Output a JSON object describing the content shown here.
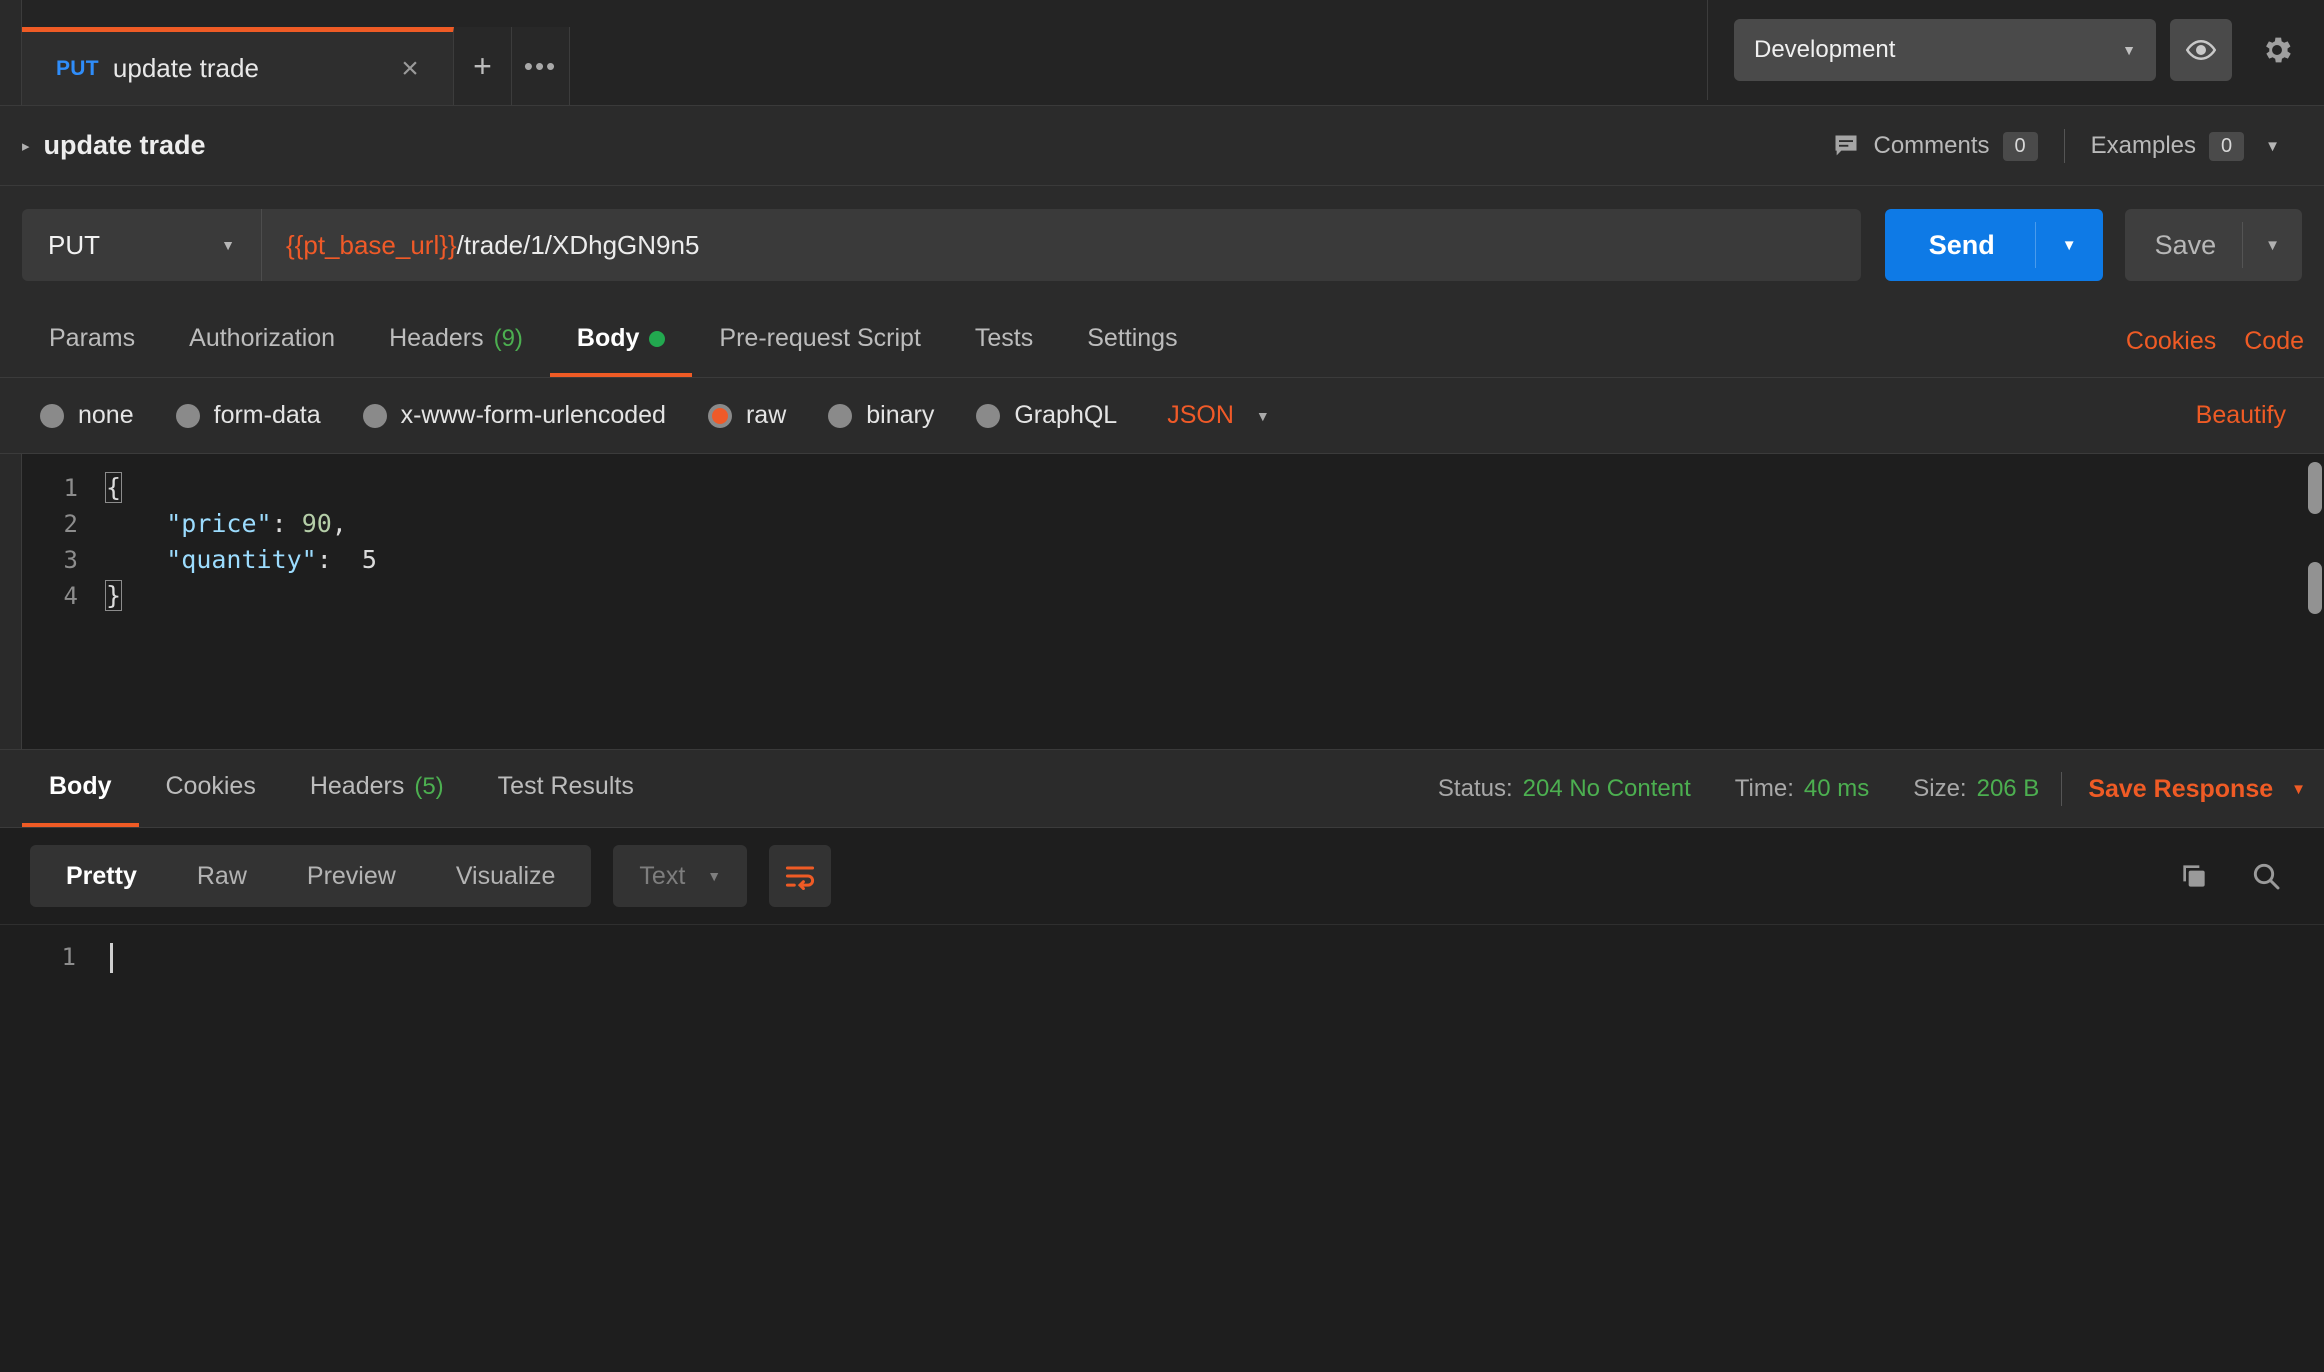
{
  "window": {
    "tab": {
      "method": "PUT",
      "name": "update trade",
      "close_label": "×",
      "new_tab_label": "+",
      "more_label": "•••"
    },
    "environment": {
      "selected": "Development",
      "caret": "▼"
    },
    "icons": {
      "eye": "eye-icon",
      "gear": "gear-icon"
    }
  },
  "breadcrumb": {
    "expander": "▸",
    "title": "update trade",
    "comments_label": "Comments",
    "comments_count": "0",
    "examples_label": "Examples",
    "examples_count": "0",
    "caret": "▼"
  },
  "request": {
    "method": "PUT",
    "method_caret": "▼",
    "url_variable": "{{pt_base_url}}",
    "url_path": "/trade/1/XDhgGN9n5",
    "send_label": "Send",
    "send_caret": "▼",
    "save_label": "Save",
    "save_caret": "▼",
    "tabs": [
      {
        "label": "Params",
        "count": "",
        "active": false
      },
      {
        "label": "Authorization",
        "count": "",
        "active": false
      },
      {
        "label": "Headers",
        "count": "(9)",
        "active": false
      },
      {
        "label": "Body",
        "count": "",
        "active": true
      },
      {
        "label": "Pre-request Script",
        "count": "",
        "active": false
      },
      {
        "label": "Tests",
        "count": "",
        "active": false
      },
      {
        "label": "Settings",
        "count": "",
        "active": false
      }
    ],
    "cookies_link": "Cookies",
    "code_link": "Code",
    "body_types": [
      {
        "label": "none",
        "selected": false
      },
      {
        "label": "form-data",
        "selected": false
      },
      {
        "label": "x-www-form-urlencoded",
        "selected": false
      },
      {
        "label": "raw",
        "selected": true
      },
      {
        "label": "binary",
        "selected": false
      },
      {
        "label": "GraphQL",
        "selected": false
      }
    ],
    "raw_format": "JSON",
    "raw_format_caret": "▼",
    "beautify_label": "Beautify",
    "body_lines": [
      {
        "number": "1",
        "text": "{"
      },
      {
        "number": "2",
        "text": "    \"price\": 90,"
      },
      {
        "number": "3",
        "text": "    \"quantity\":  5"
      },
      {
        "number": "4",
        "text": "}"
      }
    ],
    "body_code": {
      "line1_brace": "{",
      "line2_key": "\"price\"",
      "line2_colon": ": ",
      "line2_value": "90",
      "line2_comma": ",",
      "line3_key": "\"quantity\"",
      "line3_colon": ":  ",
      "line3_value": "5",
      "line4_brace": "}"
    }
  },
  "response": {
    "tabs": [
      {
        "label": "Body",
        "count": "",
        "active": true
      },
      {
        "label": "Cookies",
        "count": "",
        "active": false
      },
      {
        "label": "Headers",
        "count": "(5)",
        "active": false
      },
      {
        "label": "Test Results",
        "count": "",
        "active": false
      }
    ],
    "status_label": "Status:",
    "status_value": "204 No Content",
    "time_label": "Time:",
    "time_value": "40 ms",
    "size_label": "Size:",
    "size_value": "206 B",
    "save_response_label": "Save Response",
    "save_response_caret": "▼",
    "view_modes": [
      {
        "label": "Pretty",
        "active": true
      },
      {
        "label": "Raw",
        "active": false
      },
      {
        "label": "Preview",
        "active": false
      },
      {
        "label": "Visualize",
        "active": false
      }
    ],
    "format_select": "Text",
    "format_caret": "▼",
    "wrap_icon": "word-wrap-icon",
    "copy_icon": "copy-icon",
    "search_icon": "search-icon",
    "body_line_number": "1",
    "body_text": ""
  },
  "colors": {
    "accent_orange": "#ef5b25",
    "send_blue": "#0e7ae6",
    "method_blue": "#2f8dfa",
    "success_green": "#4caf50",
    "panel_bg": "#2b2b2b",
    "editor_bg": "#1e1e1e"
  }
}
